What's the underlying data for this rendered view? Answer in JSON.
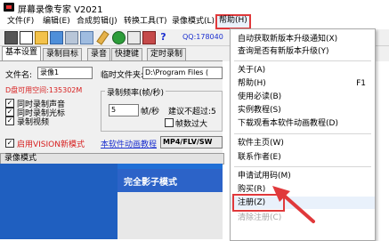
{
  "app": {
    "title": "屏幕录像专家 V2021"
  },
  "menu": [
    {
      "label": "文件(F)"
    },
    {
      "label": "编辑(E)"
    },
    {
      "label": "合成剪辑(J)"
    },
    {
      "label": "转换工具(T)"
    },
    {
      "label": "录像模式(L)"
    },
    {
      "label": "帮助(H)"
    }
  ],
  "toolbar": {
    "hint": "QQ:178040"
  },
  "tabs": [
    {
      "label": "基本设置"
    },
    {
      "label": "录制目标"
    },
    {
      "label": "录音"
    },
    {
      "label": "快捷键"
    },
    {
      "label": "定时录制"
    }
  ],
  "form": {
    "filename_label": "文件名:",
    "filename_value": "录像1",
    "tempdir_label": "临时文件夹:",
    "tempdir_value": "D:\\Program Files (",
    "disk_space": "D盘可用空间:135302M",
    "freq_group": "录制频率(帧/秒)",
    "fps_value": "5",
    "fps_unit": "帧/秒",
    "suggest": "建议不超过:5",
    "max_frame": "帧数过大",
    "opt_audio": "同时录制声音",
    "opt_cursor": "同时录制光标",
    "opt_video": "录制视频",
    "opt_vision": "启用VISION新模式",
    "tutorial_link": "本软件动画教程",
    "format": "MP4/FLV/SW"
  },
  "mode": {
    "label": "录像模式"
  },
  "preview": {
    "title": "完全影子模式"
  },
  "help_menu": {
    "items": [
      {
        "label": "自动获取新版本升级通知(X)",
        "shortcut": ""
      },
      {
        "label": "查询是否有新版本升级(Y)",
        "shortcut": ""
      },
      {
        "label": "关于(A)",
        "shortcut": ""
      },
      {
        "label": "帮助(H)",
        "shortcut": "F1"
      },
      {
        "label": "使用必读(B)",
        "shortcut": ""
      },
      {
        "label": "实例教程(S)",
        "shortcut": ""
      },
      {
        "label": "下载观看本软件动画教程(D)",
        "shortcut": ""
      },
      {
        "label": "软件主页(W)",
        "shortcut": ""
      },
      {
        "label": "联系作者(E)",
        "shortcut": ""
      },
      {
        "label": "申请试用码(M)",
        "shortcut": ""
      },
      {
        "label": "购买(R)",
        "shortcut": ""
      },
      {
        "label": "注册(Z)",
        "shortcut": ""
      },
      {
        "label": "清除注册(C)",
        "shortcut": ""
      }
    ]
  },
  "colors": {
    "highlight": "#e0393b",
    "link": "#1b2fcf",
    "preview": "#1f6fd6"
  }
}
